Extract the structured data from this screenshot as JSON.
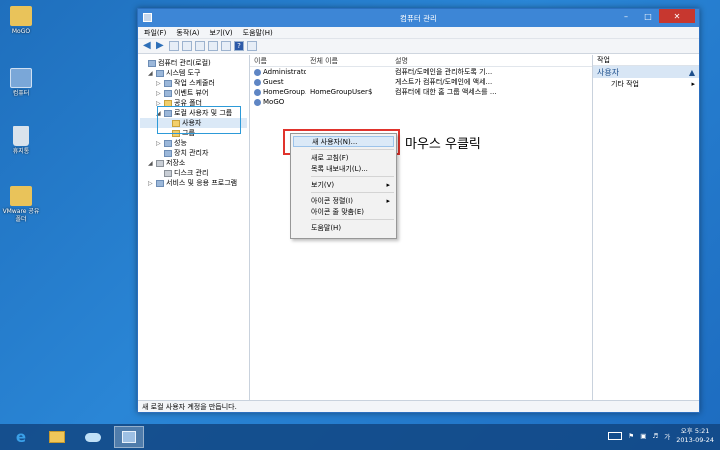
{
  "desktop": {
    "icons": [
      {
        "label": "MoGO"
      },
      {
        "label": "컴퓨터"
      },
      {
        "label": "휴지통"
      },
      {
        "label": "VMware 공유 폴더"
      }
    ]
  },
  "window": {
    "title": "컴퓨터 관리",
    "menu": [
      "파일(F)",
      "동작(A)",
      "보기(V)",
      "도움말(H)"
    ],
    "tree": [
      {
        "label": "컴퓨터 관리(로컬)",
        "indent": 0,
        "expander": ""
      },
      {
        "label": "시스템 도구",
        "indent": 1,
        "expander": "◢"
      },
      {
        "label": "작업 스케줄러",
        "indent": 2,
        "expander": "▷"
      },
      {
        "label": "이벤트 뷰어",
        "indent": 2,
        "expander": "▷"
      },
      {
        "label": "공유 폴더",
        "indent": 2,
        "expander": "▷"
      },
      {
        "label": "로컬 사용자 및 그룹",
        "indent": 2,
        "expander": "◢"
      },
      {
        "label": "사용자",
        "indent": 3,
        "expander": ""
      },
      {
        "label": "그룹",
        "indent": 3,
        "expander": ""
      },
      {
        "label": "성능",
        "indent": 2,
        "expander": "▷"
      },
      {
        "label": "장치 관리자",
        "indent": 2,
        "expander": ""
      },
      {
        "label": "저장소",
        "indent": 1,
        "expander": "◢"
      },
      {
        "label": "디스크 관리",
        "indent": 2,
        "expander": ""
      },
      {
        "label": "서비스 및 응용 프로그램",
        "indent": 1,
        "expander": "▷"
      }
    ],
    "columns": {
      "name": "이름",
      "full": "전체 이름",
      "desc": "설명"
    },
    "rows": [
      {
        "name": "Administrator",
        "full": "",
        "desc": "컴퓨터/도메인을 관리하도록 기..."
      },
      {
        "name": "Guest",
        "full": "",
        "desc": "게스트가 컴퓨터/도메인에 액세..."
      },
      {
        "name": "HomeGroup...",
        "full": "HomeGroupUser$",
        "desc": "컴퓨터에 대한 홈 그룹 액세스를 ..."
      },
      {
        "name": "MoGO",
        "full": "",
        "desc": ""
      }
    ],
    "actions": {
      "header": "작업",
      "selected": "사용자",
      "more": "기타 작업"
    },
    "status": "새 로컬 사용자 계정을 만듭니다."
  },
  "context_menu": {
    "items": [
      {
        "label": "새 사용자(N)...",
        "arrow": "",
        "highlight": true
      },
      {
        "sep": true
      },
      {
        "label": "새로 고침(F)",
        "arrow": ""
      },
      {
        "label": "목록 내보내기(L)...",
        "arrow": ""
      },
      {
        "sep": true
      },
      {
        "label": "보기(V)",
        "arrow": "▸"
      },
      {
        "sep": true
      },
      {
        "label": "아이콘 정렬(I)",
        "arrow": "▸"
      },
      {
        "label": "아이콘 줄 맞춤(E)",
        "arrow": ""
      },
      {
        "sep": true
      },
      {
        "label": "도움말(H)",
        "arrow": ""
      }
    ]
  },
  "annotation": {
    "text": "마우스 우클릭"
  },
  "taskbar": {
    "time": "오후 5:21",
    "date": "2013-09-24"
  }
}
